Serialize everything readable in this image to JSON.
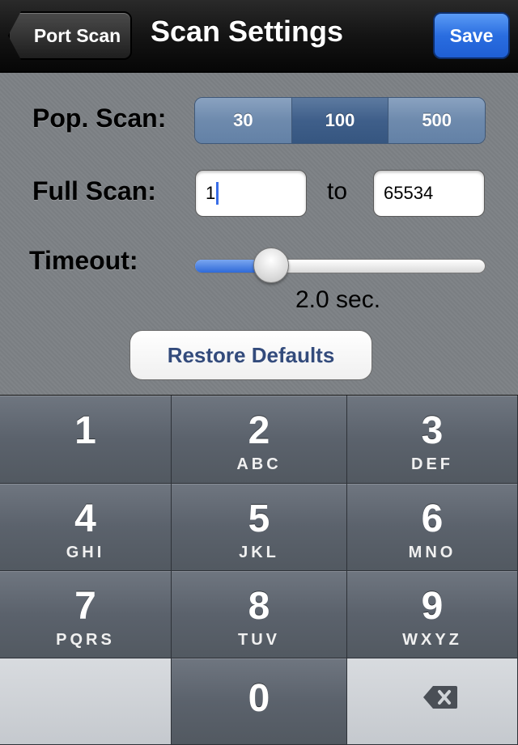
{
  "navbar": {
    "back_label": "Port Scan",
    "title": "Scan Settings",
    "save_label": "Save"
  },
  "settings": {
    "pop_scan": {
      "label": "Pop. Scan:",
      "options": [
        "30",
        "100",
        "500"
      ],
      "selected": "100"
    },
    "full_scan": {
      "label": "Full Scan:",
      "from_value": "1",
      "to_label": "to",
      "to_value": "65534"
    },
    "timeout": {
      "label": "Timeout:",
      "value_text": "2.0 sec.",
      "level": 0.23
    },
    "restore_label": "Restore Defaults"
  },
  "keypad": {
    "keys": [
      {
        "num": "1",
        "letters": ""
      },
      {
        "num": "2",
        "letters": "ABC"
      },
      {
        "num": "3",
        "letters": "DEF"
      },
      {
        "num": "4",
        "letters": "GHI"
      },
      {
        "num": "5",
        "letters": "JKL"
      },
      {
        "num": "6",
        "letters": "MNO"
      },
      {
        "num": "7",
        "letters": "PQRS"
      },
      {
        "num": "8",
        "letters": "TUV"
      },
      {
        "num": "9",
        "letters": "WXYZ"
      },
      {
        "num": "0",
        "letters": ""
      }
    ],
    "delete_icon": "backspace-icon"
  },
  "colors": {
    "accent": "#2a6de0",
    "restore_text": "#334b7c",
    "caret": "#3a6ee8"
  }
}
